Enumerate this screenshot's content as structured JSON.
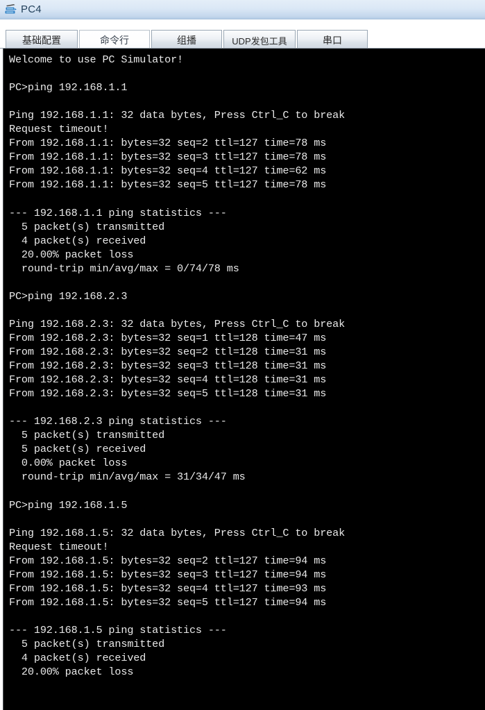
{
  "window": {
    "title": "PC4",
    "icon": "pc-device-icon"
  },
  "tabs": [
    {
      "label": "基础配置",
      "name": "tab-basic-config",
      "selected": false
    },
    {
      "label": "命令行",
      "name": "tab-command-line",
      "selected": true
    },
    {
      "label": "组播",
      "name": "tab-multicast",
      "selected": false
    },
    {
      "label": "UDP发包工具",
      "name": "tab-udp-packet-tool",
      "selected": false
    },
    {
      "label": "串口",
      "name": "tab-serial-port",
      "selected": false
    }
  ],
  "terminal": {
    "prompt": "PC>",
    "welcome": "Welcome to use PC Simulator!",
    "colors": {
      "background": "#000000",
      "foreground": "#e9e9e9"
    },
    "sessions": [
      {
        "command": "PC>ping 192.168.1.1",
        "header": "Ping 192.168.1.1: 32 data bytes, Press Ctrl_C to break",
        "replies": [
          "Request timeout!",
          "From 192.168.1.1: bytes=32 seq=2 ttl=127 time=78 ms",
          "From 192.168.1.1: bytes=32 seq=3 ttl=127 time=78 ms",
          "From 192.168.1.1: bytes=32 seq=4 ttl=127 time=62 ms",
          "From 192.168.1.1: bytes=32 seq=5 ttl=127 time=78 ms"
        ],
        "stats_header": "--- 192.168.1.1 ping statistics ---",
        "stats": [
          "  5 packet(s) transmitted",
          "  4 packet(s) received",
          "  20.00% packet loss",
          "  round-trip min/avg/max = 0/74/78 ms"
        ]
      },
      {
        "command": "PC>ping 192.168.2.3",
        "header": "Ping 192.168.2.3: 32 data bytes, Press Ctrl_C to break",
        "replies": [
          "From 192.168.2.3: bytes=32 seq=1 ttl=128 time=47 ms",
          "From 192.168.2.3: bytes=32 seq=2 ttl=128 time=31 ms",
          "From 192.168.2.3: bytes=32 seq=3 ttl=128 time=31 ms",
          "From 192.168.2.3: bytes=32 seq=4 ttl=128 time=31 ms",
          "From 192.168.2.3: bytes=32 seq=5 ttl=128 time=31 ms"
        ],
        "stats_header": "--- 192.168.2.3 ping statistics ---",
        "stats": [
          "  5 packet(s) transmitted",
          "  5 packet(s) received",
          "  0.00% packet loss",
          "  round-trip min/avg/max = 31/34/47 ms"
        ]
      },
      {
        "command": "PC>ping 192.168.1.5",
        "header": "Ping 192.168.1.5: 32 data bytes, Press Ctrl_C to break",
        "replies": [
          "Request timeout!",
          "From 192.168.1.5: bytes=32 seq=2 ttl=127 time=94 ms",
          "From 192.168.1.5: bytes=32 seq=3 ttl=127 time=94 ms",
          "From 192.168.1.5: bytes=32 seq=4 ttl=127 time=93 ms",
          "From 192.168.1.5: bytes=32 seq=5 ttl=127 time=94 ms"
        ],
        "stats_header": "--- 192.168.1.5 ping statistics ---",
        "stats": [
          "  5 packet(s) transmitted",
          "  4 packet(s) received",
          "  20.00% packet loss"
        ]
      }
    ],
    "full_text": "Welcome to use PC Simulator!\n\nPC>ping 192.168.1.1\n\nPing 192.168.1.1: 32 data bytes, Press Ctrl_C to break\nRequest timeout!\nFrom 192.168.1.1: bytes=32 seq=2 ttl=127 time=78 ms\nFrom 192.168.1.1: bytes=32 seq=3 ttl=127 time=78 ms\nFrom 192.168.1.1: bytes=32 seq=4 ttl=127 time=62 ms\nFrom 192.168.1.1: bytes=32 seq=5 ttl=127 time=78 ms\n\n--- 192.168.1.1 ping statistics ---\n  5 packet(s) transmitted\n  4 packet(s) received\n  20.00% packet loss\n  round-trip min/avg/max = 0/74/78 ms\n\nPC>ping 192.168.2.3\n\nPing 192.168.2.3: 32 data bytes, Press Ctrl_C to break\nFrom 192.168.2.3: bytes=32 seq=1 ttl=128 time=47 ms\nFrom 192.168.2.3: bytes=32 seq=2 ttl=128 time=31 ms\nFrom 192.168.2.3: bytes=32 seq=3 ttl=128 time=31 ms\nFrom 192.168.2.3: bytes=32 seq=4 ttl=128 time=31 ms\nFrom 192.168.2.3: bytes=32 seq=5 ttl=128 time=31 ms\n\n--- 192.168.2.3 ping statistics ---\n  5 packet(s) transmitted\n  5 packet(s) received\n  0.00% packet loss\n  round-trip min/avg/max = 31/34/47 ms\n\nPC>ping 192.168.1.5\n\nPing 192.168.1.5: 32 data bytes, Press Ctrl_C to break\nRequest timeout!\nFrom 192.168.1.5: bytes=32 seq=2 ttl=127 time=94 ms\nFrom 192.168.1.5: bytes=32 seq=3 ttl=127 time=94 ms\nFrom 192.168.1.5: bytes=32 seq=4 ttl=127 time=93 ms\nFrom 192.168.1.5: bytes=32 seq=5 ttl=127 time=94 ms\n\n--- 192.168.1.5 ping statistics ---\n  5 packet(s) transmitted\n  4 packet(s) received\n  20.00% packet loss"
  }
}
